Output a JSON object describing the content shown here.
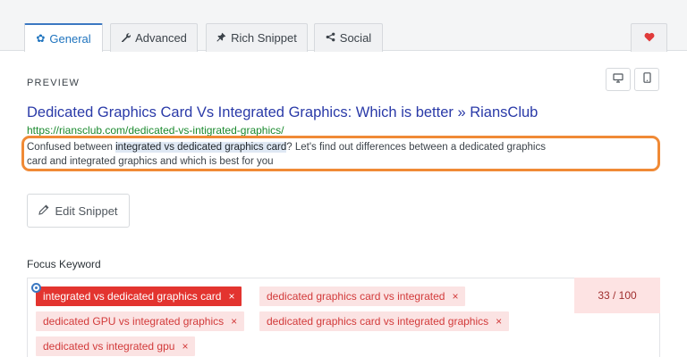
{
  "tabs": [
    {
      "label": "General",
      "icon": "gear-icon",
      "active": true
    },
    {
      "label": "Advanced",
      "icon": "wrench-icon",
      "active": false
    },
    {
      "label": "Rich Snippet",
      "icon": "pin-icon",
      "active": false
    },
    {
      "label": "Social",
      "icon": "share-icon",
      "active": false
    }
  ],
  "favorite": {
    "icon": "heart-icon",
    "color": "#e03a3a"
  },
  "preview": {
    "label": "PREVIEW",
    "title": "Dedicated Graphics Card Vs Integrated Graphics: Which is better » RiansClub",
    "url": "https://riansclub.com/dedicated-vs-intigrated-graphics/",
    "description_before": "Confused between ",
    "description_highlight": "integrated vs dedicated graphics card",
    "description_after": "? Let's find out differences between a dedicated graphics card and integrated graphics and which is best for you",
    "highlight_color": "#f08a36"
  },
  "edit_snippet": {
    "label": "Edit Snippet",
    "icon": "pencil-icon"
  },
  "focus_keyword": {
    "label": "Focus Keyword",
    "score": "33 / 100",
    "keywords": [
      "integrated vs dedicated graphics card",
      "dedicated graphics card vs integrated",
      "dedicated GPU vs integrated graphics",
      "dedicated graphics card vs integrated graphics",
      "dedicated vs integrated gpu"
    ],
    "remove_glyph": "×"
  },
  "colors": {
    "accent": "#3b78c2",
    "title_link": "#2a3aa8",
    "url": "#1a8a2e",
    "keyword_primary": "#e3342f",
    "keyword_bg": "#fbe3e3"
  }
}
